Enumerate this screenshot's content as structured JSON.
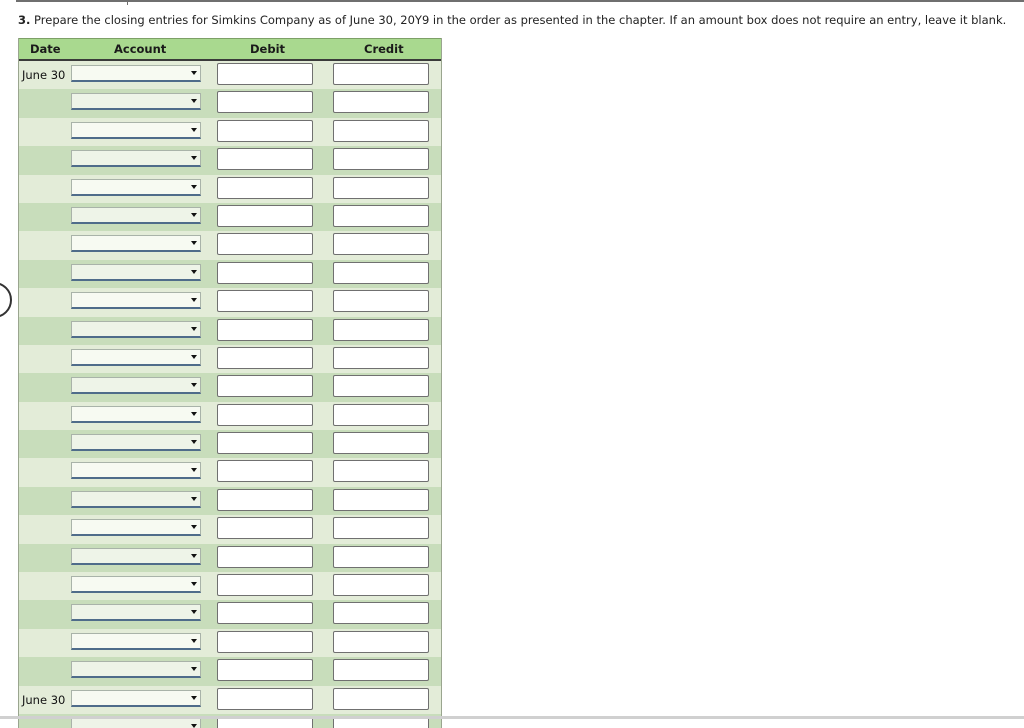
{
  "instruction": {
    "number": "3.",
    "text": "Prepare the closing entries for Simkins Company as of June 30, 20Y9 in the order as presented in the chapter. If an amount box does not require an entry, leave it blank."
  },
  "journal": {
    "headers": {
      "date": "Date",
      "account": "Account",
      "debit": "Debit",
      "credit": "Credit"
    },
    "rows": [
      {
        "date": "June 30",
        "account": "",
        "debit": "",
        "credit": ""
      },
      {
        "date": "",
        "account": "",
        "debit": "",
        "credit": ""
      },
      {
        "date": "",
        "account": "",
        "debit": "",
        "credit": ""
      },
      {
        "date": "",
        "account": "",
        "debit": "",
        "credit": ""
      },
      {
        "date": "",
        "account": "",
        "debit": "",
        "credit": ""
      },
      {
        "date": "",
        "account": "",
        "debit": "",
        "credit": ""
      },
      {
        "date": "",
        "account": "",
        "debit": "",
        "credit": ""
      },
      {
        "date": "",
        "account": "",
        "debit": "",
        "credit": ""
      },
      {
        "date": "",
        "account": "",
        "debit": "",
        "credit": ""
      },
      {
        "date": "",
        "account": "",
        "debit": "",
        "credit": ""
      },
      {
        "date": "",
        "account": "",
        "debit": "",
        "credit": ""
      },
      {
        "date": "",
        "account": "",
        "debit": "",
        "credit": ""
      },
      {
        "date": "",
        "account": "",
        "debit": "",
        "credit": ""
      },
      {
        "date": "",
        "account": "",
        "debit": "",
        "credit": ""
      },
      {
        "date": "",
        "account": "",
        "debit": "",
        "credit": ""
      },
      {
        "date": "",
        "account": "",
        "debit": "",
        "credit": ""
      },
      {
        "date": "",
        "account": "",
        "debit": "",
        "credit": ""
      },
      {
        "date": "",
        "account": "",
        "debit": "",
        "credit": ""
      },
      {
        "date": "",
        "account": "",
        "debit": "",
        "credit": ""
      },
      {
        "date": "",
        "account": "",
        "debit": "",
        "credit": ""
      },
      {
        "date": "",
        "account": "",
        "debit": "",
        "credit": ""
      },
      {
        "date": "",
        "account": "",
        "debit": "",
        "credit": ""
      },
      {
        "date": "June 30",
        "account": "",
        "debit": "",
        "credit": ""
      },
      {
        "date": "",
        "account": "",
        "debit": "",
        "credit": ""
      }
    ]
  },
  "colors": {
    "header_green": "#a9d98f",
    "row_light": "#e3ecd8",
    "row_dark": "#c8ddbb"
  }
}
